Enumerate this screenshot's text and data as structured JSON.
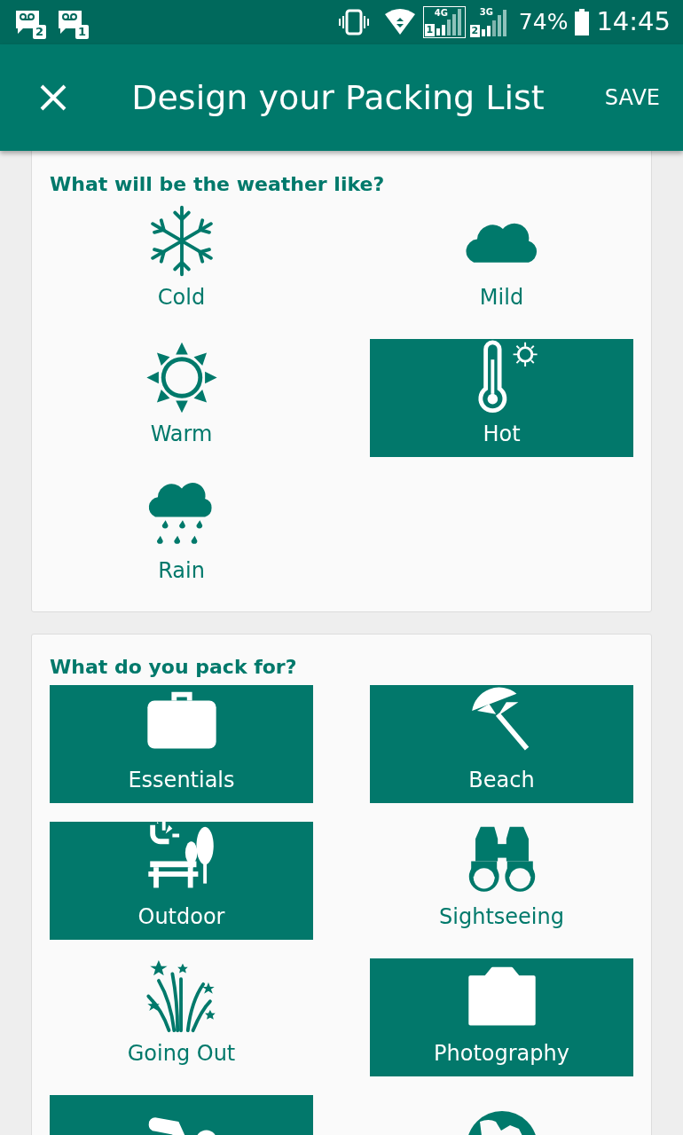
{
  "status_bar": {
    "notifications": [
      "2",
      "1"
    ],
    "sim1": {
      "network": "4G",
      "slot": "1"
    },
    "sim2": {
      "network": "3G",
      "slot": "2"
    },
    "battery": "74%",
    "time": "14:45"
  },
  "app_bar": {
    "title": "Design your Packing List",
    "action": "SAVE"
  },
  "sections": [
    {
      "heading": "What will be the weather like?",
      "options": [
        {
          "kind": "cold",
          "label": "Cold",
          "selected": false
        },
        {
          "kind": "mild",
          "label": "Mild",
          "selected": false
        },
        {
          "kind": "warm",
          "label": "Warm",
          "selected": false
        },
        {
          "kind": "hot",
          "label": "Hot",
          "selected": true
        },
        {
          "kind": "rain",
          "label": "Rain",
          "selected": false
        }
      ]
    },
    {
      "heading": "What do you pack for?",
      "options": [
        {
          "kind": "essentials",
          "label": "Essentials",
          "selected": true
        },
        {
          "kind": "beach",
          "label": "Beach",
          "selected": true
        },
        {
          "kind": "outdoor",
          "label": "Outdoor",
          "selected": true
        },
        {
          "kind": "sightseeing",
          "label": "Sightseeing",
          "selected": false
        },
        {
          "kind": "goingout",
          "label": "Going Out",
          "selected": false
        },
        {
          "kind": "photography",
          "label": "Photography",
          "selected": true
        },
        {
          "kind": "swimming",
          "selected": true
        },
        {
          "kind": "globe",
          "selected": false
        }
      ]
    }
  ]
}
